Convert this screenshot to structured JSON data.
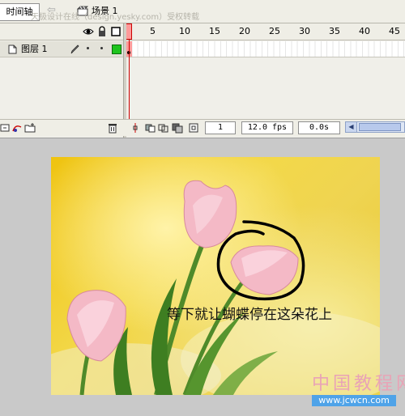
{
  "timeline": {
    "tab_label": "时间轴",
    "scene_label": "场景 1",
    "watermark": "天极设计在线（design.yesky.com）受权转载",
    "ruler_labels": [
      "1",
      "5",
      "10",
      "15",
      "20",
      "25",
      "30",
      "35",
      "40",
      "45"
    ],
    "layer": {
      "name": "图层 1"
    },
    "status": {
      "current_frame": "1",
      "frame_rate": "12.0 fps",
      "elapsed_time": "0.0s"
    }
  },
  "stage": {
    "caption": "等下就让蝴蝶停在这朵花上"
  },
  "site": {
    "title": "中国教程网",
    "url": "www.jcwcn.com"
  },
  "colors": {
    "playhead": "#cc0000",
    "outline_swatch": "#1ec41e",
    "panel_bg": "#f0efe9",
    "workspace_bg": "#c9c9c9"
  }
}
